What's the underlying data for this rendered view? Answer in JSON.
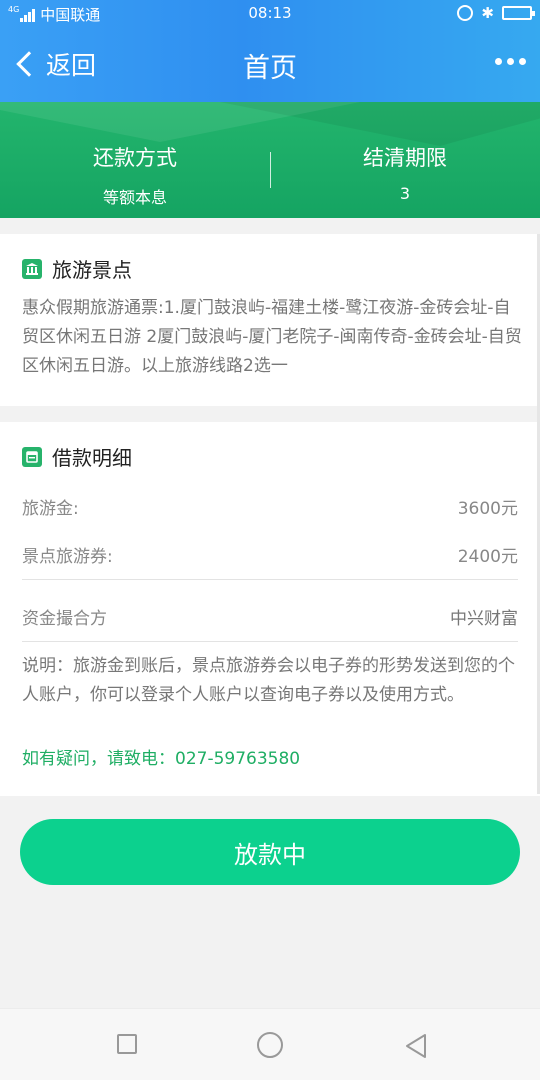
{
  "status_bar": {
    "network": "4G",
    "carrier": "中国联通",
    "time": "08:13",
    "icons": [
      "signal-icon",
      "lock-rotation-icon",
      "bluetooth-icon",
      "battery-icon"
    ]
  },
  "header": {
    "back_label": "返回",
    "title": "首页",
    "more_icon": "more-dots-icon"
  },
  "summary": {
    "repay_method_label": "还款方式",
    "repay_method_value": "等额本息",
    "term_label": "结清期限",
    "term_value": "3"
  },
  "attraction": {
    "title": "旅游景点",
    "icon": "bank-building-icon",
    "description": "惠众假期旅游通票:1.厦门鼓浪屿-福建土楼-鹭江夜游-金砖会址-自贸区休闲五日游 2厦门鼓浪屿-厦门老院子-闽南传奇-金砖会址-自贸区休闲五日游。以上旅游线路2选一"
  },
  "loan": {
    "title": "借款明细",
    "icon": "document-icon",
    "rows": [
      {
        "label": "旅游金:",
        "value": "3600元"
      },
      {
        "label": "景点旅游券:",
        "value": "2400元"
      },
      {
        "label": "资金撮合方",
        "value": "中兴财富"
      }
    ],
    "note": "说明：旅游金到账后，景点旅游券会以电子券的形势发送到您的个人账户，你可以登录个人账户以查询电子券以及使用方式。",
    "hotline": "如有疑问，请致电：027-59763580"
  },
  "action": {
    "button_label": "放款中"
  },
  "navbar": {
    "icons": [
      "recent-apps-icon",
      "home-icon",
      "back-triangle-icon"
    ]
  },
  "colors": {
    "header_blue": "#2f8ff0",
    "summary_green": "#1aa865",
    "button_green": "#0cd18e",
    "hotline_green": "#1fae64"
  }
}
